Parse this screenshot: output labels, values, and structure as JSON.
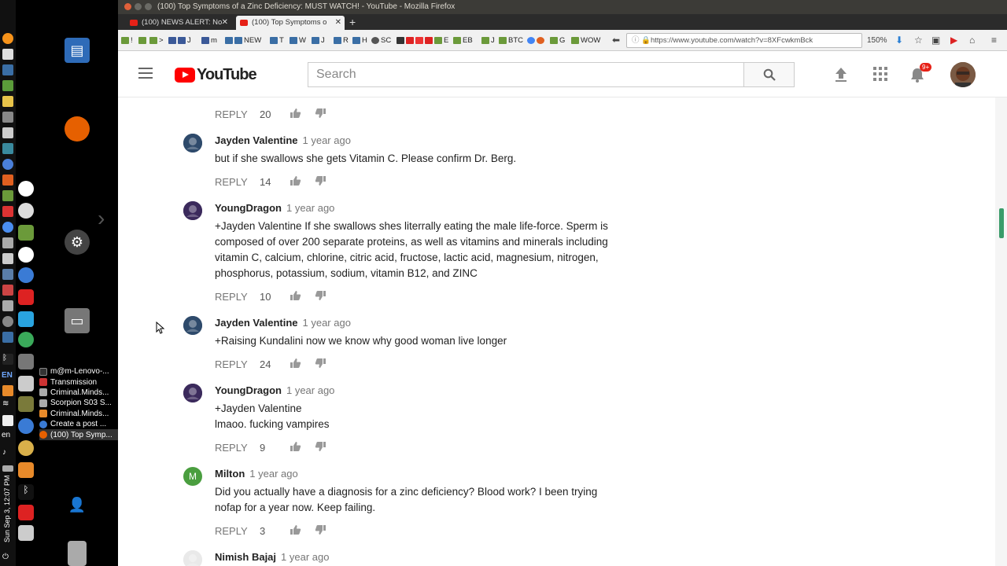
{
  "window": {
    "title": "(100) Top Symptoms of a Zinc Deficiency: MUST WATCH! - YouTube - Mozilla Firefox"
  },
  "tabs": [
    {
      "label": "(100) NEWS ALERT: No"
    },
    {
      "label": "(100) Top Symptoms o"
    }
  ],
  "bookmarks": [
    "!",
    "",
    ">",
    "J",
    "m",
    "NEW",
    "T",
    "W",
    "J",
    "R",
    "H",
    "SC",
    "E",
    "EB",
    "J",
    "BTC",
    "G",
    "G",
    "WOW"
  ],
  "url": "https://www.youtube.com/watch?v=8XFcwkmBck",
  "zoom": "150%",
  "youtube": {
    "logo_text": "YouTube",
    "search_placeholder": "Search",
    "notification_count": "9+"
  },
  "taskbar": {
    "tasks": [
      "m@m-Lenovo-...",
      "Transmission",
      "Criminal.Minds...",
      "Scorpion S03 S...",
      "Criminal.Minds...",
      "Create a post ...",
      "(100) Top Symp..."
    ],
    "lang": "EN",
    "lang_small": "en",
    "clock": "Sun Sep 3, 12:07 PM"
  },
  "comments": [
    {
      "author": "",
      "time": "",
      "body": [],
      "reply": "REPLY",
      "likes": "20"
    },
    {
      "author": "Jayden Valentine",
      "time": "1 year ago",
      "body": [
        "but if she swallows she gets Vitamin C. Please confirm Dr. Berg."
      ],
      "reply": "REPLY",
      "likes": "14",
      "avatar_color": "#2e4a6b"
    },
    {
      "author": "YoungDragon",
      "time": "1 year ago",
      "body": [
        "+Jayden Valentine If she swallows shes literrally eating the male life-force. Sperm is composed of over 200 separate proteins, as well as vitamins and minerals including vitamin C, calcium, chlorine, citric acid, fructose, lactic acid, magnesium, nitrogen, phosphorus, potassium, sodium, vitamin B12, and ZINC"
      ],
      "reply": "REPLY",
      "likes": "10",
      "avatar_color": "#3b2a5c"
    },
    {
      "author": "Jayden Valentine",
      "time": "1 year ago",
      "body": [
        "+Raising Kundalini now we know why good woman live longer"
      ],
      "reply": "REPLY",
      "likes": "24",
      "avatar_color": "#2e4a6b"
    },
    {
      "author": "YoungDragon",
      "time": "1 year ago",
      "body": [
        "+Jayden Valentine",
        "lmaoo. fucking vampires"
      ],
      "reply": "REPLY",
      "likes": "9",
      "avatar_color": "#3b2a5c"
    },
    {
      "author": "Milton",
      "time": "1 year ago",
      "body": [
        "Did you actually have a diagnosis for a zinc deficiency? Blood work? I been trying nofap for a year now. Keep failing."
      ],
      "reply": "REPLY",
      "likes": "3",
      "avatar_letter": "M",
      "avatar_color": "#4a9e3f"
    },
    {
      "author": "Nimish Bajaj",
      "time": "1 year ago",
      "body": [],
      "reply": "",
      "likes": "",
      "avatar_color": "#e9e9e9"
    }
  ]
}
